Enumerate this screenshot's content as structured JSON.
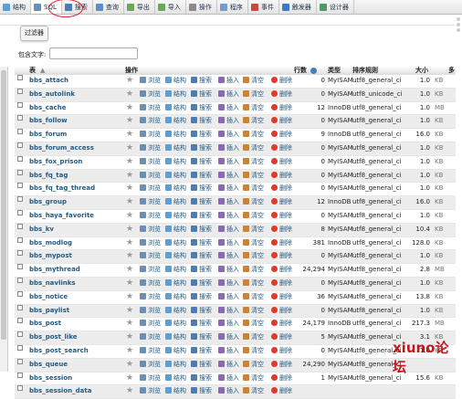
{
  "toolbar": {
    "tabs": [
      {
        "label": "结构",
        "icon": "structure-icon",
        "color": "#5aa0d8"
      },
      {
        "label": "SQL",
        "icon": "sql-icon",
        "color": "#6b8fb3"
      },
      {
        "label": "搜索",
        "icon": "search-icon",
        "color": "#4a7db8"
      },
      {
        "label": "查询",
        "icon": "query-icon",
        "color": "#5a8fc8"
      },
      {
        "label": "导出",
        "icon": "export-icon",
        "color": "#6aa85a"
      },
      {
        "label": "导入",
        "icon": "import-icon",
        "color": "#6aa85a"
      },
      {
        "label": "操作",
        "icon": "wrench-icon",
        "color": "#8a8a8a"
      },
      {
        "label": "程序",
        "icon": "routines-icon",
        "color": "#7a9ac8"
      },
      {
        "label": "事件",
        "icon": "clock-icon",
        "color": "#c84a3a"
      },
      {
        "label": "触发器",
        "icon": "trigger-icon",
        "color": "#3a7ac8"
      },
      {
        "label": "设计器",
        "icon": "designer-icon",
        "color": "#4a9a6a"
      }
    ]
  },
  "filter": {
    "legend": "过滤器",
    "label": "包含文字:",
    "value": ""
  },
  "header": {
    "table": "表",
    "operations": "操作",
    "rows": "行数",
    "type": "类型",
    "collation": "排序规则",
    "size": "大小",
    "overhead": "多"
  },
  "actions": {
    "browse": "浏览",
    "structure": "结构",
    "search": "搜索",
    "insert": "插入",
    "empty": "清空",
    "drop": "删除"
  },
  "rows": [
    {
      "name": "bbs_attach",
      "rows": "0",
      "engine": "MyISAM",
      "collation": "utf8_general_ci",
      "size": "1.0",
      "unit": "KB"
    },
    {
      "name": "bbs_autolink",
      "rows": "0",
      "engine": "MyISAM",
      "collation": "utf8_unicode_ci",
      "size": "1.0",
      "unit": "KB"
    },
    {
      "name": "bbs_cache",
      "rows": "12",
      "engine": "InnoDB",
      "collation": "utf8_general_ci",
      "size": "1.0",
      "unit": "MB"
    },
    {
      "name": "bbs_follow",
      "rows": "0",
      "engine": "MyISAM",
      "collation": "utf8_general_ci",
      "size": "1.0",
      "unit": "KB"
    },
    {
      "name": "bbs_forum",
      "rows": "9",
      "engine": "InnoDB",
      "collation": "utf8_general_ci",
      "size": "16.0",
      "unit": "KB"
    },
    {
      "name": "bbs_forum_access",
      "rows": "0",
      "engine": "MyISAM",
      "collation": "utf8_general_ci",
      "size": "1.0",
      "unit": "KB"
    },
    {
      "name": "bbs_fox_prison",
      "rows": "0",
      "engine": "MyISAM",
      "collation": "utf8_general_ci",
      "size": "1.0",
      "unit": "KB"
    },
    {
      "name": "bbs_fq_tag",
      "rows": "0",
      "engine": "MyISAM",
      "collation": "utf8_general_ci",
      "size": "1.0",
      "unit": "KB"
    },
    {
      "name": "bbs_fq_tag_thread",
      "rows": "0",
      "engine": "MyISAM",
      "collation": "utf8_general_ci",
      "size": "1.0",
      "unit": "KB"
    },
    {
      "name": "bbs_group",
      "rows": "12",
      "engine": "InnoDB",
      "collation": "utf8_general_ci",
      "size": "16.0",
      "unit": "KB"
    },
    {
      "name": "bbs_haya_favorite",
      "rows": "0",
      "engine": "MyISAM",
      "collation": "utf8_general_ci",
      "size": "1.0",
      "unit": "KB"
    },
    {
      "name": "bbs_kv",
      "rows": "8",
      "engine": "MyISAM",
      "collation": "utf8_general_ci",
      "size": "10.4",
      "unit": "KB"
    },
    {
      "name": "bbs_modlog",
      "rows": "381",
      "engine": "InnoDB",
      "collation": "utf8_general_ci",
      "size": "128.0",
      "unit": "KB"
    },
    {
      "name": "bbs_mypost",
      "rows": "0",
      "engine": "MyISAM",
      "collation": "utf8_general_ci",
      "size": "1.0",
      "unit": "KB"
    },
    {
      "name": "bbs_mythread",
      "rows": "24,294",
      "engine": "MyISAM",
      "collation": "utf8_general_ci",
      "size": "2.8",
      "unit": "MB"
    },
    {
      "name": "bbs_navlinks",
      "rows": "0",
      "engine": "MyISAM",
      "collation": "utf8_general_ci",
      "size": "1.0",
      "unit": "KB"
    },
    {
      "name": "bbs_notice",
      "rows": "36",
      "engine": "MyISAM",
      "collation": "utf8_general_ci",
      "size": "13.8",
      "unit": "KB"
    },
    {
      "name": "bbs_paylist",
      "rows": "0",
      "engine": "MyISAM",
      "collation": "utf8_general_ci",
      "size": "1.0",
      "unit": "KB"
    },
    {
      "name": "bbs_post",
      "rows": "24,179",
      "engine": "InnoDB",
      "collation": "utf8_general_ci",
      "size": "217.3",
      "unit": "MB"
    },
    {
      "name": "bbs_post_like",
      "rows": "5",
      "engine": "MyISAM",
      "collation": "utf8_general_ci",
      "size": "3.1",
      "unit": "KB"
    },
    {
      "name": "bbs_post_search",
      "rows": "0",
      "engine": "MyISAM",
      "collation": "utf8_general_ci",
      "size": "1.0",
      "unit": "KB"
    },
    {
      "name": "bbs_queue",
      "rows": "24,290",
      "engine": "MyISAM",
      "collation": "utf8_general_ci",
      "size": "",
      "unit": ""
    },
    {
      "name": "bbs_session",
      "rows": "1",
      "engine": "MyISAM",
      "collation": "utf8_general_ci",
      "size": "15.6",
      "unit": "KB"
    },
    {
      "name": "bbs_session_data",
      "rows": "",
      "engine": "",
      "collation": "",
      "size": "",
      "unit": ""
    }
  ],
  "watermark": "xiuno论坛"
}
